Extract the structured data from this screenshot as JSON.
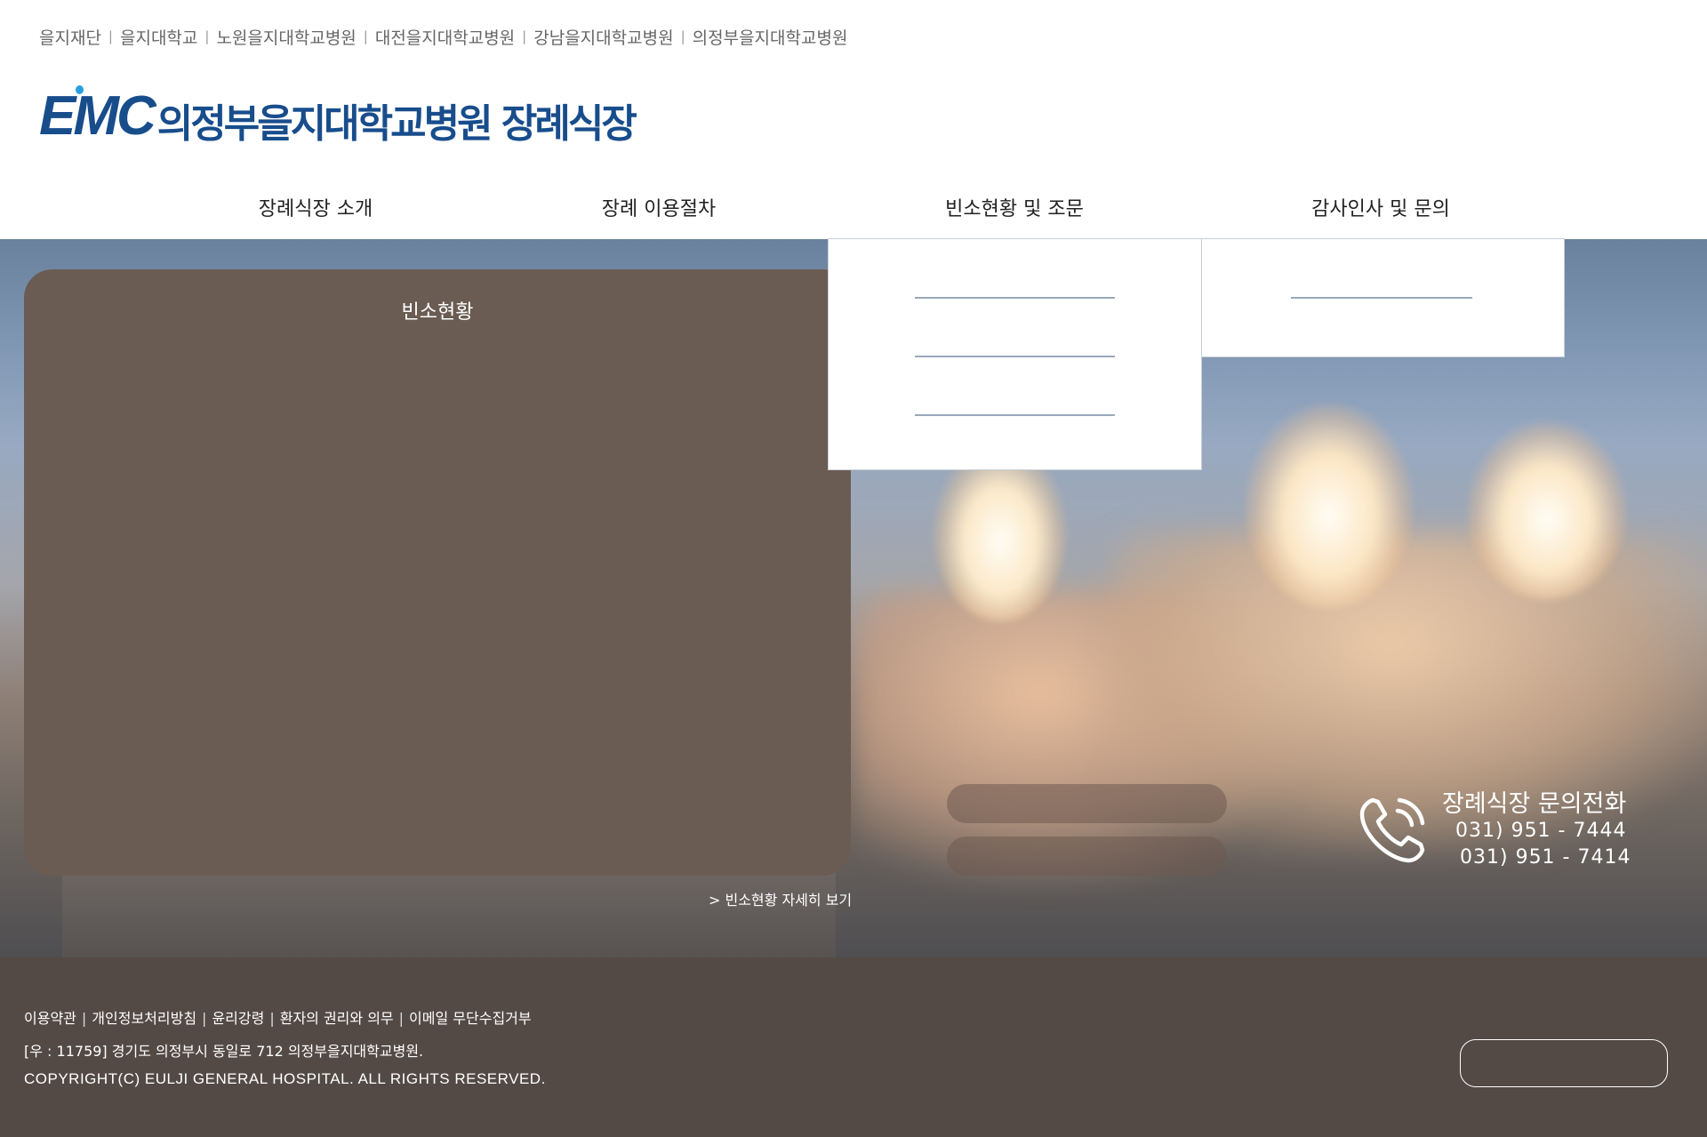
{
  "top_links": [
    "을지재단",
    "을지대학교",
    "노원을지대학교병원",
    "대전을지대학교병원",
    "강남을지대학교병원",
    "의정부을지대학교병원"
  ],
  "logo": {
    "mark": "EMC",
    "text": "의정부을지대학교병원 장례식장"
  },
  "nav": {
    "items": [
      "장례식장 소개",
      "장례 이용절차",
      "빈소현황 및 조문",
      "감사인사 및 문의"
    ]
  },
  "status": {
    "title": "빈소현황",
    "more_link": "> 빈소현황 자세히 보기"
  },
  "contact": {
    "title": "장례식장 문의전화",
    "phones": [
      "031) 951 - 7444",
      "031) 951 - 7414"
    ]
  },
  "footer": {
    "links": [
      "이용약관",
      "개인정보처리방침",
      "윤리강령",
      "환자의 권리와 의무",
      "이메일 무단수집거부"
    ],
    "address": "[우 : 11759] 경기도 의정부시 동일로 712 의정부을지대학교병원.",
    "copyright": "COPYRIGHT(C) EULJI GENERAL HOSPITAL. ALL RIGHTS RESERVED."
  },
  "colors": {
    "brand": "#184d8c",
    "panel": "#6a5c53",
    "footer": "#544a45"
  }
}
